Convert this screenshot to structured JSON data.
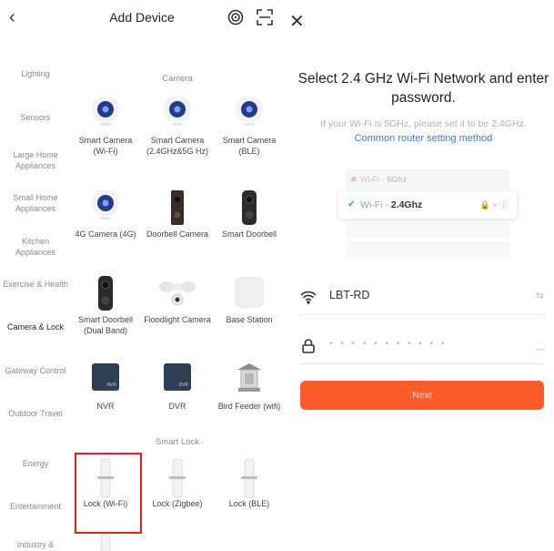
{
  "left": {
    "title": "Add Device",
    "categories": [
      "Lighting",
      "Sensors",
      "Large Home Appliances",
      "Small Home Appliances",
      "Kitchen Appliances",
      "Exercise & Health",
      "Camera & Lock",
      "Gateway Control",
      "Outdoor Travel",
      "Energy",
      "Entertainment",
      "Industry &"
    ],
    "sections": {
      "camera": "Camera",
      "smart_lock": "Smart Lock"
    },
    "devices": [
      "Smart Camera (Wi-Fi)",
      "Smart Camera (2.4GHz&5G Hz)",
      "Smart Camera (BLE)",
      "4G Camera (4G)",
      "Doorbell Camera",
      "Smart Doorbell",
      "Smart Doorbell (Dual Band)",
      "Floodlight Camera",
      "Base Station",
      "NVR",
      "DVR",
      "Bird Feeder (wifi)",
      "Lock (Wi-Fi)",
      "Lock (Zigbee)",
      "Lock (BLE)"
    ],
    "nvr_tag": "NVR",
    "dvr_tag": "DVR"
  },
  "right": {
    "title": "Select 2.4 GHz Wi-Fi Network and enter password.",
    "hint": "If your Wi-Fi is 5GHz, please set it to be 2.4GHz.",
    "link": "Common router setting method",
    "illus": {
      "row5_prefix": "Wi-Fi - ",
      "row5_band": "5Ghz",
      "row24_prefix": "Wi-Fi - ",
      "row24_band": "2.4Ghz"
    },
    "ssid": "LBT-RD",
    "password_mask": "• • • • • • • • • • •",
    "next_label": "Next"
  },
  "colors": {
    "accent": "#ff5a2a",
    "link": "#3b7ed8",
    "selected_border": "#e52222"
  }
}
